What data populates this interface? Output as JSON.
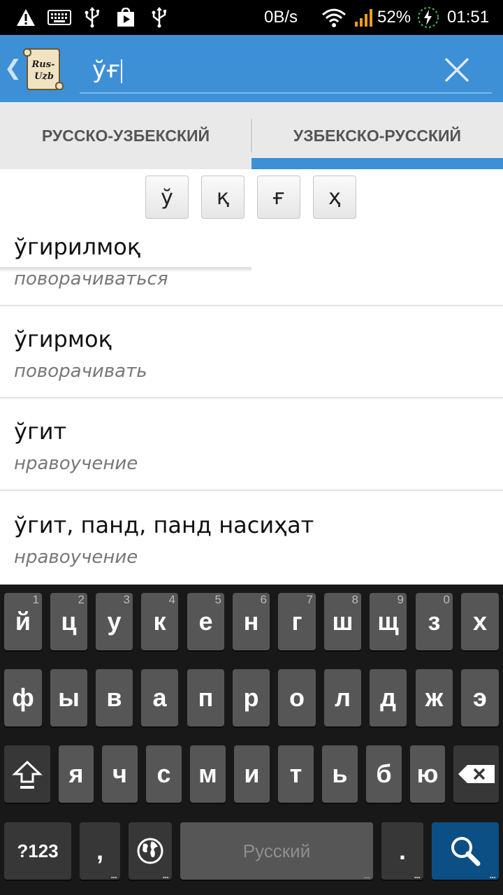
{
  "status_bar": {
    "icons_left": [
      "warning-icon",
      "keyboard-icon",
      "usb-icon",
      "play-store-icon",
      "usb-icon"
    ],
    "net_speed": "0B/s",
    "battery_percent": "52%",
    "time": "01:51",
    "icons_right": [
      "wifi-icon",
      "signal-icon",
      "battery-charging-icon"
    ]
  },
  "app_bar": {
    "logo_text": "Rus-Uzb",
    "search": {
      "value": "ўғ"
    }
  },
  "tabs": {
    "items": [
      {
        "label": "РУССКО-УЗБЕКСКИЙ"
      },
      {
        "label": "УЗБЕКСКО-РУССКИЙ"
      }
    ],
    "selected_index": 1
  },
  "special_letters": [
    "ў",
    "қ",
    "ғ",
    "ҳ"
  ],
  "results": [
    {
      "word": "ўгирилмоқ",
      "translation": "поворачиваться"
    },
    {
      "word": "ўгирмоқ",
      "translation": "поворачивать"
    },
    {
      "word": "ўгит",
      "translation": "нравоучение"
    },
    {
      "word": "ўгит, панд, панд насиҳат",
      "translation": "нравоучение"
    }
  ],
  "keyboard": {
    "row1": [
      {
        "label": "й",
        "hint": "1"
      },
      {
        "label": "ц",
        "hint": "2"
      },
      {
        "label": "у",
        "hint": "3"
      },
      {
        "label": "к",
        "hint": "4"
      },
      {
        "label": "е",
        "hint": "5"
      },
      {
        "label": "н",
        "hint": "6"
      },
      {
        "label": "г",
        "hint": "7"
      },
      {
        "label": "ш",
        "hint": "8"
      },
      {
        "label": "щ",
        "hint": "9"
      },
      {
        "label": "з",
        "hint": "0"
      },
      {
        "label": "х",
        "hint": ""
      }
    ],
    "row2": [
      "ф",
      "ы",
      "в",
      "а",
      "п",
      "р",
      "о",
      "л",
      "д",
      "ж",
      "э"
    ],
    "row3": [
      "я",
      "ч",
      "с",
      "м",
      "и",
      "т",
      "ь",
      "б",
      "ю"
    ],
    "symbols_label": "?123",
    "comma_label": ",",
    "space_label": "Русский",
    "period_label": ".",
    "hint_dots": "..."
  }
}
